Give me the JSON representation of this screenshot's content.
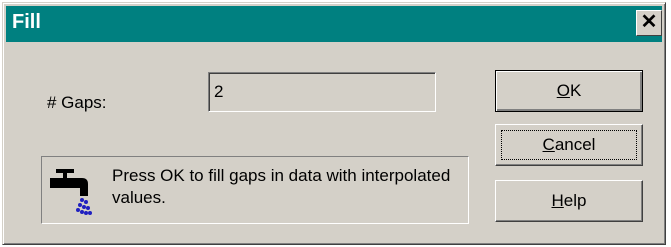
{
  "dialog": {
    "title": "Fill",
    "close_symbol": "✕"
  },
  "gaps": {
    "label": "# Gaps:",
    "value": "2"
  },
  "buttons": {
    "ok": {
      "mnemonic": "O",
      "rest": "K"
    },
    "cancel": {
      "mnemonic": "C",
      "rest": "ancel"
    },
    "help": {
      "mnemonic": "H",
      "rest": "elp"
    }
  },
  "info": {
    "icon": "faucet-icon",
    "text": "Press OK to fill gaps in data with interpolated values."
  },
  "colors": {
    "titlebar": "#008080",
    "face": "#d4d0c8"
  }
}
